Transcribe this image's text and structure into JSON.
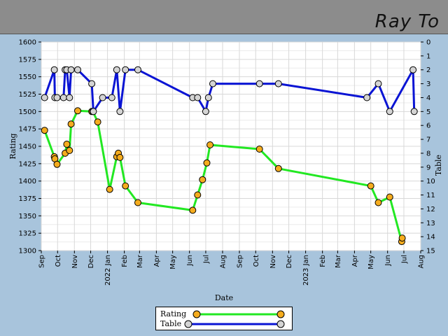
{
  "header": {
    "player_name": "Ray To",
    "background": "#8c8c8c"
  },
  "legend": [
    {
      "label": "Rating",
      "line_color": "#22e822",
      "marker_color": "#f5ac1e"
    },
    {
      "label": "Table",
      "line_color": "#0a14d4",
      "marker_color": "#d4d4d4"
    }
  ],
  "chart_data": {
    "type": "line",
    "xlabel": "Date",
    "ylabel": "Rating",
    "y2label": "Table",
    "ylim": [
      1300,
      1600
    ],
    "yticks": [
      1300,
      1325,
      1350,
      1375,
      1400,
      1425,
      1450,
      1475,
      1500,
      1525,
      1550,
      1575,
      1600
    ],
    "y2lim": [
      15,
      0
    ],
    "y2ticks": [
      0,
      1,
      2,
      3,
      4,
      5,
      6,
      7,
      8,
      9,
      10,
      11,
      12,
      13,
      14,
      15
    ],
    "xlim": [
      "2021-09-01",
      "2023-08-01"
    ],
    "xticks": [
      "Sep",
      "Oct",
      "Nov",
      "Dec",
      "2022 Jan",
      "Feb",
      "Mar",
      "Apr",
      "May",
      "Jun",
      "Jul",
      "Aug",
      "Sep",
      "Oct",
      "Nov",
      "Dec",
      "2023 Jan",
      "Feb",
      "Mar",
      "Apr",
      "May",
      "Jun",
      "Jul",
      "Aug"
    ],
    "grid": true,
    "series": [
      {
        "name": "Rating",
        "color": "#22e822",
        "marker": "#f5ac1e",
        "axis": "left",
        "x": [
          "2021-09-07",
          "2021-09-25",
          "2021-09-26",
          "2021-09-30",
          "2021-10-15",
          "2021-10-18",
          "2021-10-23",
          "2021-10-26",
          "2021-11-07",
          "2021-12-03",
          "2021-12-05",
          "2021-12-14",
          "2022-01-05",
          "2022-01-18",
          "2022-01-21",
          "2022-01-24",
          "2022-02-03",
          "2022-02-26",
          "2022-06-07",
          "2022-06-16",
          "2022-06-25",
          "2022-07-03",
          "2022-07-09",
          "2022-10-08",
          "2022-11-12",
          "2023-05-01",
          "2023-05-15",
          "2023-06-05",
          "2023-06-27",
          "2023-06-28"
        ],
        "y": [
          1473,
          1435,
          1432,
          1424,
          1440,
          1453,
          1444,
          1482,
          1501,
          1500,
          1500,
          1485,
          1388,
          1435,
          1440,
          1434,
          1393,
          1369,
          1358,
          1380,
          1402,
          1426,
          1452,
          1446,
          1418,
          1393,
          1369,
          1377,
          1313,
          1318
        ]
      },
      {
        "name": "Table",
        "color": "#0a14d4",
        "marker": "#d4d4d4",
        "axis": "right",
        "x": [
          "2021-09-07",
          "2021-09-25",
          "2021-09-26",
          "2021-09-30",
          "2021-10-12",
          "2021-10-15",
          "2021-10-18",
          "2021-10-23",
          "2021-10-26",
          "2021-11-07",
          "2021-12-03",
          "2021-12-06",
          "2021-12-23",
          "2022-01-09",
          "2022-01-18",
          "2022-01-24",
          "2022-02-03",
          "2022-02-26",
          "2022-06-07",
          "2022-06-16",
          "2022-07-01",
          "2022-07-06",
          "2022-07-14",
          "2022-10-08",
          "2022-11-12",
          "2023-04-24",
          "2023-05-15",
          "2023-06-05",
          "2023-07-18",
          "2023-07-20"
        ],
        "y": [
          4,
          2,
          4,
          4,
          4,
          2,
          2,
          4,
          2,
          2,
          3,
          5,
          4,
          4,
          2,
          5,
          2,
          2,
          4,
          4,
          5,
          4,
          3,
          3,
          3,
          4,
          3,
          5,
          2,
          5
        ]
      }
    ]
  }
}
